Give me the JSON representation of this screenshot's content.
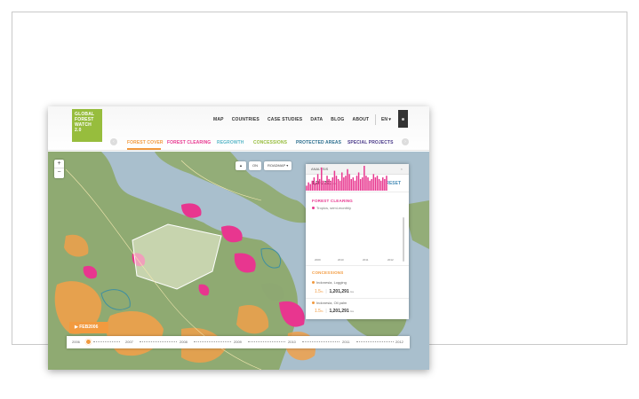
{
  "header": {
    "logo_lines": [
      "GLOBAL",
      "FOREST",
      "WATCH",
      "2.0"
    ],
    "nav": [
      "MAP",
      "COUNTRIES",
      "CASE STUDIES",
      "DATA",
      "BLOG",
      "ABOUT"
    ],
    "language": "EN ▾"
  },
  "layers": [
    {
      "label": "FOREST COVER",
      "color": "#f29a3f"
    },
    {
      "label": "FOREST CLEARING",
      "color": "#e8368f"
    },
    {
      "label": "REGROWTH",
      "color": "#5bb8c9"
    },
    {
      "label": "CONCESSIONS",
      "color": "#97bd3d"
    },
    {
      "label": "PROTECTED AREAS",
      "color": "#2c6f8f"
    },
    {
      "label": "SPECIAL PROJECTS",
      "color": "#4a3a8a"
    }
  ],
  "map_tools": {
    "layer_btn": "▲",
    "toggle": "ON",
    "basemap": "ROADMAP ▾"
  },
  "zoom": {
    "in": "+",
    "out": "−"
  },
  "analysis": {
    "title": "ANALYSIS",
    "close": "×",
    "area_value": "1,201,291",
    "area_unit": "Ha",
    "reset_label": "RESET",
    "clearing_title": "FOREST CLEARING",
    "clearing_sub": "Tropics, semi-monthly",
    "histogram": [
      3,
      5,
      4,
      6,
      8,
      5,
      10,
      7,
      14,
      6,
      5,
      9,
      7,
      6,
      8,
      12,
      9,
      7,
      6,
      11,
      8,
      9,
      13,
      10,
      7,
      8,
      6,
      9,
      11,
      7,
      8,
      15,
      9,
      8,
      6,
      7,
      10,
      8,
      9,
      7,
      6,
      8,
      7,
      9
    ],
    "axis_years": [
      "2009",
      "2010",
      "2011",
      "2012"
    ],
    "concessions_title": "CONCESSIONS",
    "concessions": [
      {
        "name": "Indonesia, Logging",
        "pct": "1.5",
        "pct_unit": "%",
        "value": "1,201,291",
        "unit": "Ha"
      },
      {
        "name": "Indonesia, Oil palm",
        "pct": "1.5",
        "pct_unit": "%",
        "value": "1,201,291",
        "unit": "Ha"
      }
    ]
  },
  "timeline": {
    "play_label": "▶  FEB2006",
    "years": [
      "2006",
      "2007",
      "2008",
      "2009",
      "2010",
      "2011",
      "2012"
    ]
  },
  "colors": {
    "accent_orange": "#f29a3f",
    "accent_pink": "#e8368f",
    "brand_green": "#97bd3d",
    "link_blue": "#4c8fb9"
  }
}
